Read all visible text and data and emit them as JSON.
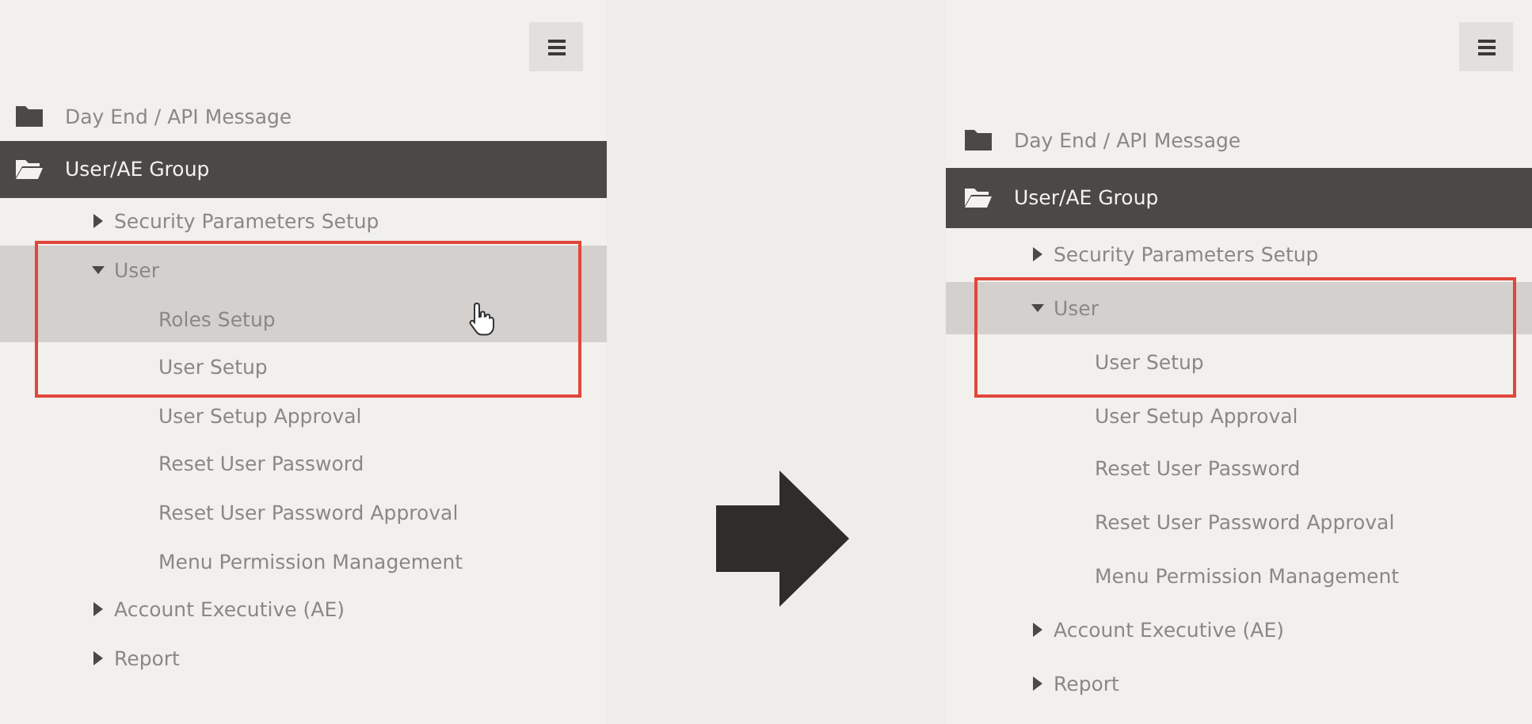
{
  "panels": [
    {
      "items": [
        {
          "label": "Day End / API Message",
          "kind": "folder",
          "expanded": false,
          "selected": false,
          "highlighted": false
        },
        {
          "label": "User/AE Group",
          "kind": "folder",
          "expanded": true,
          "selected": true,
          "highlighted": false,
          "children": [
            {
              "label": "Security Parameters Setup",
              "kind": "branch",
              "expanded": false,
              "selected": false,
              "highlighted": false
            },
            {
              "label": "User",
              "kind": "branch",
              "expanded": true,
              "selected": false,
              "highlighted": true,
              "callout": true,
              "children": [
                {
                  "label": "Roles Setup",
                  "kind": "leaf",
                  "selected": false,
                  "highlighted": true,
                  "pointer": true,
                  "callout": true
                },
                {
                  "label": "User Setup",
                  "kind": "leaf",
                  "selected": false,
                  "highlighted": false,
                  "callout": true
                },
                {
                  "label": "User Setup Approval",
                  "kind": "leaf",
                  "selected": false,
                  "highlighted": false
                },
                {
                  "label": "Reset User Password",
                  "kind": "leaf",
                  "selected": false,
                  "highlighted": false
                },
                {
                  "label": "Reset User Password Approval",
                  "kind": "leaf",
                  "selected": false,
                  "highlighted": false
                },
                {
                  "label": "Menu Permission Management",
                  "kind": "leaf",
                  "selected": false,
                  "highlighted": false
                }
              ]
            },
            {
              "label": "Account Executive (AE)",
              "kind": "branch",
              "expanded": false,
              "selected": false,
              "highlighted": false
            },
            {
              "label": "Report",
              "kind": "branch",
              "expanded": false,
              "selected": false,
              "highlighted": false
            }
          ]
        }
      ]
    },
    {
      "items": [
        {
          "label": "Day End / API Message",
          "kind": "folder",
          "expanded": false,
          "selected": false,
          "highlighted": false
        },
        {
          "label": "User/AE Group",
          "kind": "folder",
          "expanded": true,
          "selected": true,
          "highlighted": false,
          "children": [
            {
              "label": "Security Parameters Setup",
              "kind": "branch",
              "expanded": false,
              "selected": false,
              "highlighted": false
            },
            {
              "label": "User",
              "kind": "branch",
              "expanded": true,
              "selected": false,
              "highlighted": true,
              "callout": true,
              "children": [
                {
                  "label": "User Setup",
                  "kind": "leaf",
                  "selected": false,
                  "highlighted": false,
                  "callout": true
                },
                {
                  "label": "User Setup Approval",
                  "kind": "leaf",
                  "selected": false,
                  "highlighted": false
                },
                {
                  "label": "Reset User Password",
                  "kind": "leaf",
                  "selected": false,
                  "highlighted": false
                },
                {
                  "label": "Reset User Password Approval",
                  "kind": "leaf",
                  "selected": false,
                  "highlighted": false
                },
                {
                  "label": "Menu Permission Management",
                  "kind": "leaf",
                  "selected": false,
                  "highlighted": false
                }
              ]
            },
            {
              "label": "Account Executive (AE)",
              "kind": "branch",
              "expanded": false,
              "selected": false,
              "highlighted": false
            },
            {
              "label": "Report",
              "kind": "branch",
              "expanded": false,
              "selected": false,
              "highlighted": false
            }
          ]
        }
      ]
    }
  ]
}
